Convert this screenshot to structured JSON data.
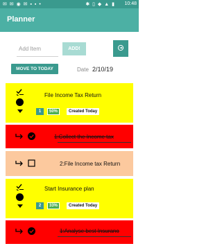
{
  "status_bar": {
    "left_icons": [
      "sms-icon",
      "mail-icon",
      "whatsapp-icon",
      "mail-icon",
      "message-icon",
      "message-icon",
      "more-icon"
    ],
    "right_icons": [
      "bluetooth-icon",
      "vibrate-icon",
      "wifi-icon",
      "signal-icon",
      "battery-icon"
    ],
    "time": "10:48"
  },
  "appbar": {
    "title": "Planner"
  },
  "add_item": {
    "placeholder": "Add Item",
    "button_label": "ADD!"
  },
  "move_to_today": {
    "label": "MOVE TO TODAY"
  },
  "date": {
    "label": "Date",
    "value": "2/10/19"
  },
  "tasks": [
    {
      "title": "File Income Tax Return",
      "number": "1",
      "progress": "50%",
      "created": "Created Today",
      "color": "#ffff00"
    },
    {
      "title": "Start Insurance plan",
      "number": "2",
      "progress": "33%",
      "created": "Created Today",
      "color": "#ffff00"
    }
  ],
  "subtasks": [
    {
      "text": "1:Collect the Income tax",
      "done": true,
      "color": "#ff0000"
    },
    {
      "text": "2:File Income tax Return",
      "done": false,
      "color": "#fcc99e"
    },
    {
      "text": "1:Analyse best Insurano",
      "done": true,
      "color": "#ff0000"
    }
  ]
}
